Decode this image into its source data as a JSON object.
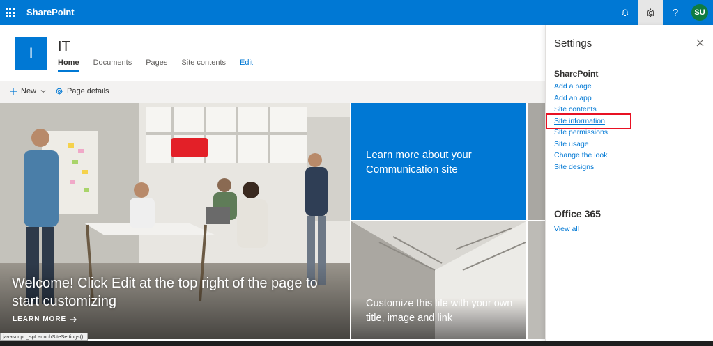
{
  "suitebar": {
    "brand": "SharePoint",
    "avatar_initials": "SU",
    "help_label": "?"
  },
  "site": {
    "logo_letter": "I",
    "title": "IT",
    "nav": [
      "Home",
      "Documents",
      "Pages",
      "Site contents",
      "Edit"
    ]
  },
  "commandbar": {
    "new_label": "New",
    "page_details_label": "Page details"
  },
  "hero": {
    "main_text": "Welcome! Click Edit at the top right of the page to start customizing",
    "learn_more": "LEARN MORE",
    "tile_blue_text": "Learn more about your Communication site",
    "tile_customize_text": "Customize this tile with your own title, image and link"
  },
  "settings": {
    "title": "Settings",
    "section_sharepoint": "SharePoint",
    "links": [
      "Add a page",
      "Add an app",
      "Site contents",
      "Site information",
      "Site permissions",
      "Site usage",
      "Change the look",
      "Site designs"
    ],
    "highlighted_link": "Site information",
    "section_office": "Office 365",
    "view_all": "View all"
  },
  "statusbar": {
    "text": "javascript:_spLaunchSiteSettings();"
  },
  "colors": {
    "brand": "#0078d4",
    "highlight": "#e81123",
    "avatar": "#107c41"
  }
}
